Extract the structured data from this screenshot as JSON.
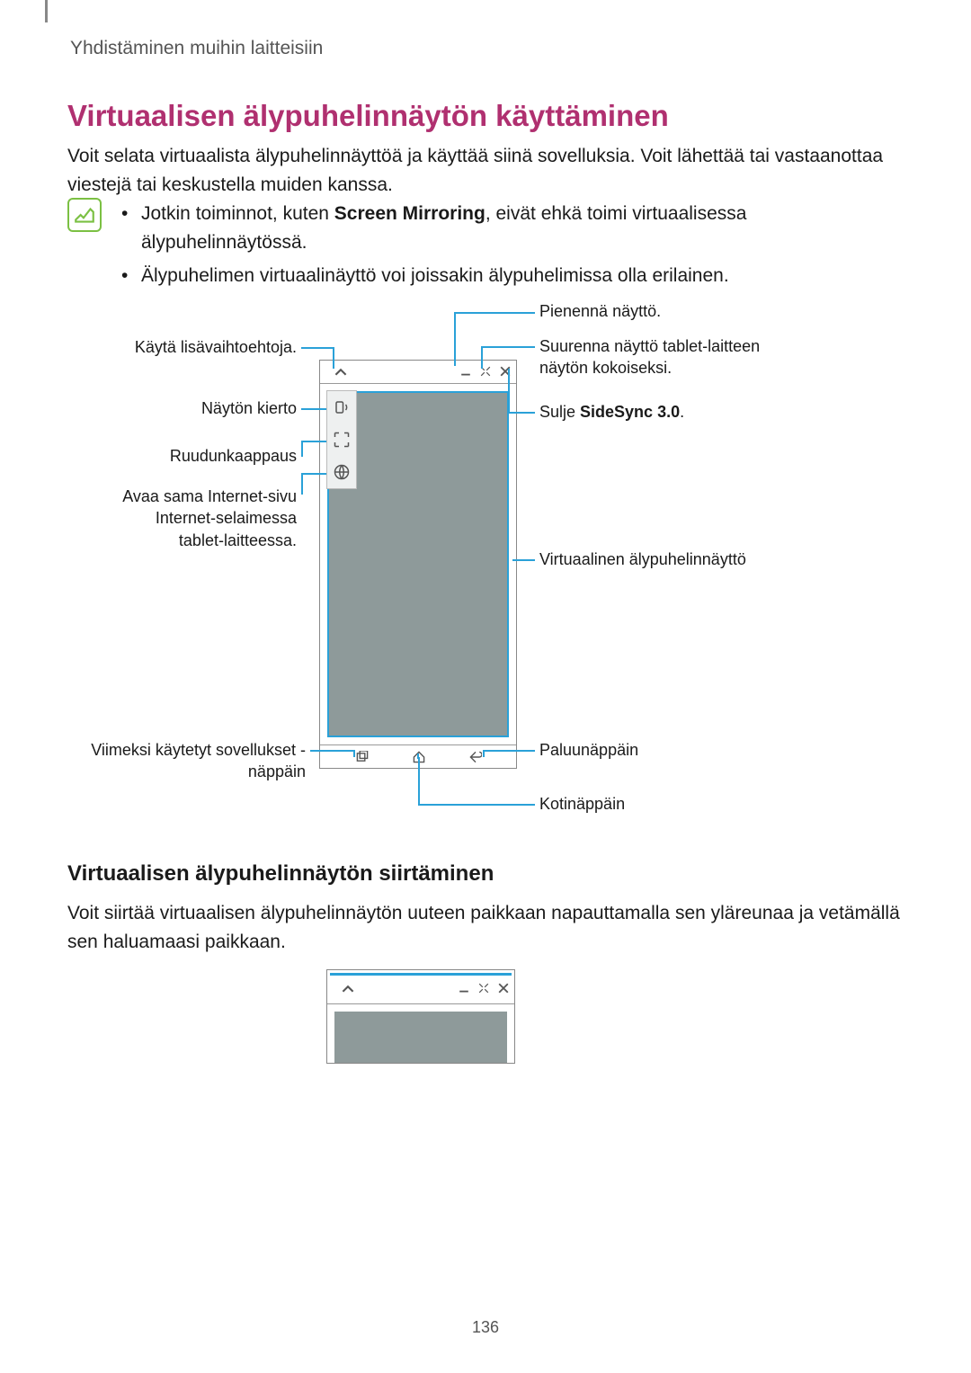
{
  "breadcrumb": "Yhdistäminen muihin laitteisiin",
  "heading": "Virtuaalisen älypuhelinnäytön käyttäminen",
  "intro": "Voit selata virtuaalista älypuhelinnäyttöä ja käyttää siinä sovelluksia. Voit lähettää tai vastaanottaa viestejä tai keskustella muiden kanssa.",
  "notes": [
    {
      "pre": "Jotkin toiminnot, kuten ",
      "bold": "Screen Mirroring",
      "post": ", eivät ehkä toimi virtuaalisessa älypuhelinnäytössä."
    },
    {
      "pre": "Älypuhelimen virtuaalinäyttö voi joissakin älypuhelimissa olla erilainen.",
      "bold": "",
      "post": ""
    }
  ],
  "labels": {
    "minimize": "Pienennä näyttö.",
    "maximize": "Suurenna näyttö tablet-laitteen näytön kokoiseksi.",
    "close_pre": "Sulje ",
    "close_bold": "SideSync 3.0",
    "close_post": ".",
    "virtual_screen": "Virtuaalinen älypuhelinnäyttö",
    "back": "Paluunäppäin",
    "home": "Kotinäppäin",
    "more_options": "Käytä lisävaihtoehtoja.",
    "rotate": "Näytön kierto",
    "screenshot": "Ruudunkaappaus",
    "browser": "Avaa sama Internet-sivu Internet-selaimessa tablet-laitteessa.",
    "recent": "Viimeksi käytetyt sovellukset -näppäin"
  },
  "subheading": "Virtuaalisen älypuhelinnäytön siirtäminen",
  "subtext": "Voit siirtää virtuaalisen älypuhelinnäytön uuteen paikkaan napauttamalla sen yläreunaa ja vetämällä sen haluamaasi paikkaan.",
  "pagenum": "136"
}
